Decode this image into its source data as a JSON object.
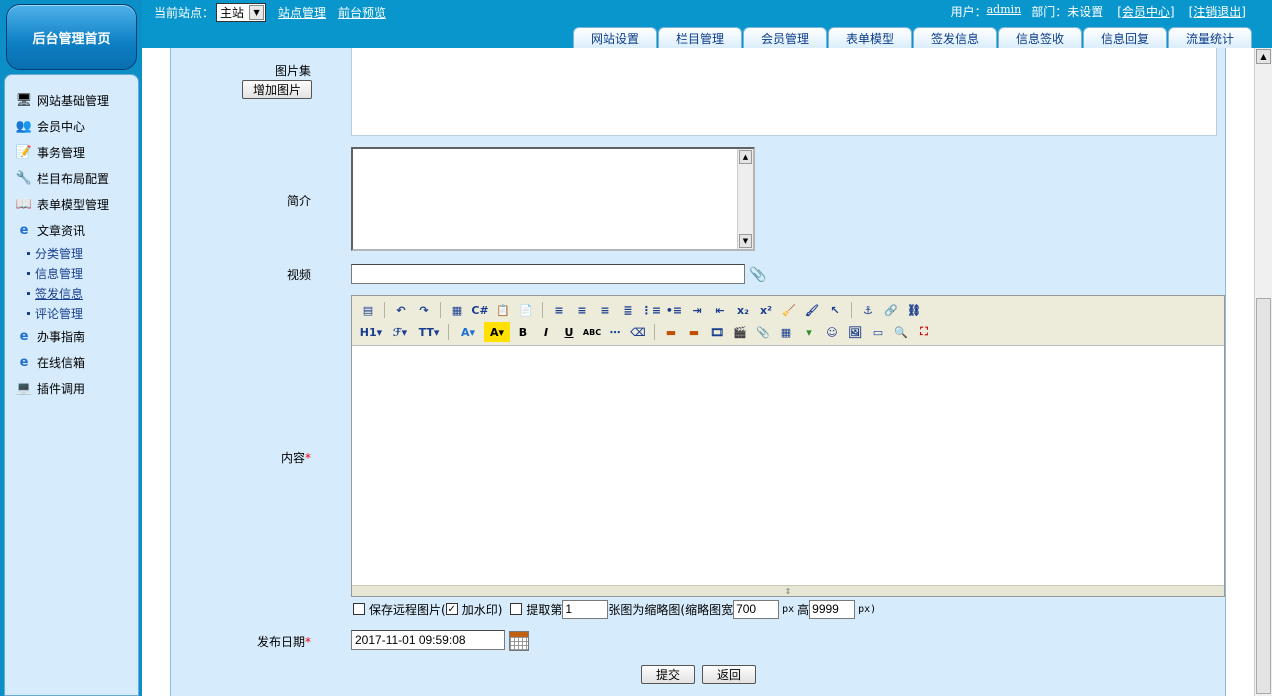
{
  "home_button": "后台管理首页",
  "topbar": {
    "site_label": "当前站点：",
    "site_value": "主站",
    "links": [
      "站点管理",
      "前台预览"
    ],
    "user_label": "用户：",
    "user_name": "admin",
    "dept_label": "部门：未设置",
    "member_center": "[会员中心]",
    "logout": "[注销退出]"
  },
  "tabs": [
    "网站设置",
    "栏目管理",
    "会员管理",
    "表单模型",
    "签发信息",
    "信息签收",
    "信息回复",
    "流量统计"
  ],
  "sidebar": {
    "items": [
      {
        "label": "网站基础管理",
        "icon": "site-icon"
      },
      {
        "label": "会员中心",
        "icon": "users-icon"
      },
      {
        "label": "事务管理",
        "icon": "tasks-icon"
      },
      {
        "label": "栏目布局配置",
        "icon": "tools-icon"
      },
      {
        "label": "表单模型管理",
        "icon": "book-icon"
      },
      {
        "label": "文章资讯",
        "icon": "ie-icon"
      }
    ],
    "subitems": [
      "分类管理",
      "信息管理",
      "签发信息",
      "评论管理"
    ],
    "items2": [
      {
        "label": "办事指南",
        "icon": "ie-icon"
      },
      {
        "label": "在线信箱",
        "icon": "ie-icon"
      },
      {
        "label": "插件调用",
        "icon": "computer-icon"
      }
    ]
  },
  "form": {
    "gallery_label": "图片集",
    "add_image": "增加图片",
    "intro_label": "简介",
    "video_label": "视频",
    "video_value": "",
    "content_label": "内容",
    "required_mark": "*",
    "toolbar": {
      "h1": "H1",
      "font": "ℱ",
      "size": "TT"
    },
    "options": {
      "save_remote": "保存远程图片(",
      "watermark": "加水印)",
      "extract_prefix": "提取第",
      "extract_num": "1",
      "extract_mid": "张图为缩略图(缩略图宽",
      "thumb_w": "700",
      "px": "px",
      "height_label": "高",
      "thumb_h": "9999",
      "px_close": "px)"
    },
    "date_label": "发布日期",
    "date_value": "2017-11-01 09:59:08",
    "submit": "提交",
    "back": "返回"
  }
}
